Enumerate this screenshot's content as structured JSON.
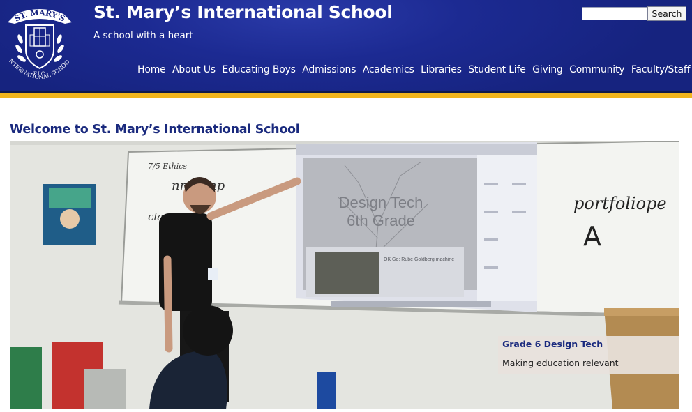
{
  "header": {
    "logo_alt": "St. Mary's International School crest",
    "logo_text_top": "ST. MARY'S",
    "logo_text_bottom": "INTERNATIONAL SCHOOL",
    "logo_initials": "F.I.C.",
    "title": "St. Mary’s International School",
    "tagline": "A school with a heart",
    "search": {
      "value": "",
      "placeholder": "",
      "button_label": "Search"
    },
    "colors": {
      "header_blue": "#1c2a92",
      "gold_strip": "#f2b51c"
    }
  },
  "nav": {
    "items": [
      {
        "label": "Home"
      },
      {
        "label": "About Us"
      },
      {
        "label": "Educating Boys"
      },
      {
        "label": "Admissions"
      },
      {
        "label": "Academics"
      },
      {
        "label": "Libraries"
      },
      {
        "label": "Student Life"
      },
      {
        "label": "Giving"
      },
      {
        "label": "Community"
      },
      {
        "label": "Faculty/Staff"
      }
    ]
  },
  "main": {
    "heading": "Welcome to St. Mary’s International School",
    "hero": {
      "board_text": [
        "7/5 Ethics",
        "nrolamp",
        "classroom",
        "portfoliope",
        "A"
      ],
      "screen_title_line1": "Design Tech",
      "screen_title_line2": "6th Grade",
      "screen_card_title": "OK Go: Rube Goldberg machine",
      "caption_title": "Grade 6 Design Tech",
      "caption_text": "Making education relevant"
    }
  }
}
